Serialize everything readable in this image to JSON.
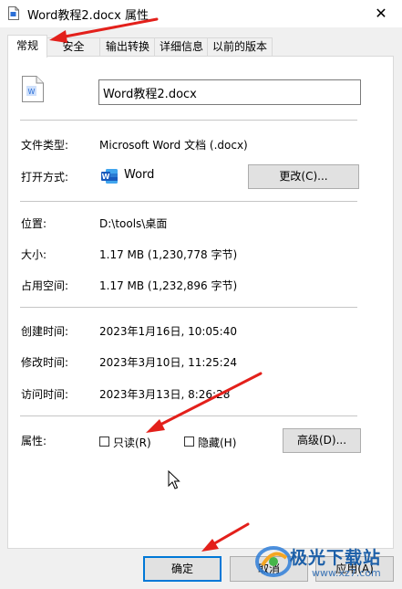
{
  "window": {
    "title": "Word教程2.docx 属性",
    "close_glyph": "✕"
  },
  "tabs": [
    {
      "label": "常规",
      "active": true
    },
    {
      "label": "安全",
      "active": false
    },
    {
      "label": "输出转换",
      "active": false
    },
    {
      "label": "详细信息",
      "active": false
    },
    {
      "label": "以前的版本",
      "active": false
    }
  ],
  "general": {
    "file_name": "Word教程2.docx",
    "file_type_label": "文件类型:",
    "file_type_value": "Microsoft Word 文档 (.docx)",
    "open_with_label": "打开方式:",
    "open_with_app": "Word",
    "change_button": "更改(C)...",
    "location_label": "位置:",
    "location_value": "D:\\tools\\桌面",
    "size_label": "大小:",
    "size_value": "1.17 MB (1,230,778 字节)",
    "size_on_disk_label": "占用空间:",
    "size_on_disk_value": "1.17 MB (1,232,896 字节)",
    "created_label": "创建时间:",
    "created_value": "2023年1月16日, 10:05:40",
    "modified_label": "修改时间:",
    "modified_value": "2023年3月10日, 11:25:24",
    "accessed_label": "访问时间:",
    "accessed_value": "2023年3月13日, 8:26:28",
    "attributes_label": "属性:",
    "readonly_label": "只读(R)",
    "readonly_checked": false,
    "hidden_label": "隐藏(H)",
    "hidden_checked": false,
    "advanced_button": "高级(D)..."
  },
  "footer": {
    "ok_button": "确定",
    "cancel_button": "取消",
    "apply_button": "应用(A)"
  },
  "watermark": {
    "brand": "极光下载站",
    "url": "www.xz7.com"
  },
  "colors": {
    "annotation_arrow": "#e3201b",
    "default_button_border": "#0078d7",
    "word_blue": "#185abd"
  }
}
